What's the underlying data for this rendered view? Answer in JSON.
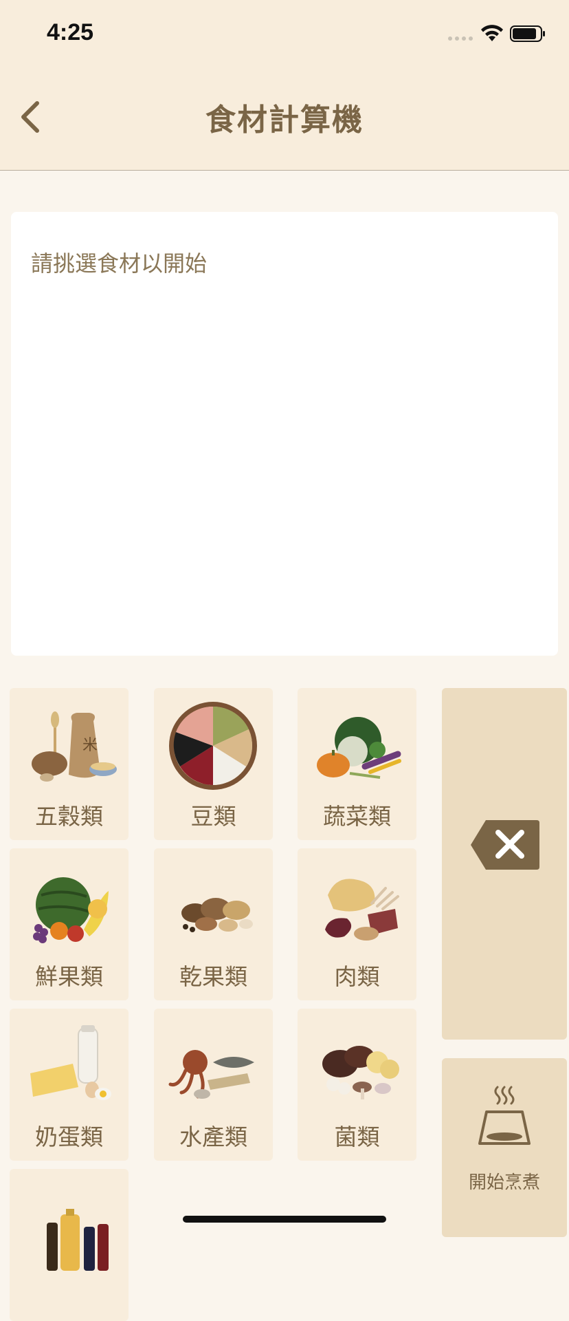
{
  "status": {
    "time": "4:25"
  },
  "nav": {
    "title": "食材計算機"
  },
  "result": {
    "placeholder": "請挑選食材以開始"
  },
  "categories": [
    {
      "label": "五穀類",
      "icon": "grains-icon"
    },
    {
      "label": "豆類",
      "icon": "beans-icon"
    },
    {
      "label": "蔬菜類",
      "icon": "vegetables-icon"
    },
    {
      "label": "鮮果類",
      "icon": "fruits-icon"
    },
    {
      "label": "乾果類",
      "icon": "nuts-icon"
    },
    {
      "label": "肉類",
      "icon": "meat-icon"
    },
    {
      "label": "奶蛋類",
      "icon": "dairy-egg-icon"
    },
    {
      "label": "水產類",
      "icon": "seafood-icon"
    },
    {
      "label": "菌類",
      "icon": "mushroom-icon"
    },
    {
      "label": "",
      "icon": "condiments-icon"
    }
  ],
  "actions": {
    "cook_label": "開始烹煮"
  },
  "colors": {
    "background": "#faf5ed",
    "bar": "#f8eddc",
    "card": "#f8eddc",
    "panel": "#ecdcc0",
    "accent": "#7a6546"
  }
}
